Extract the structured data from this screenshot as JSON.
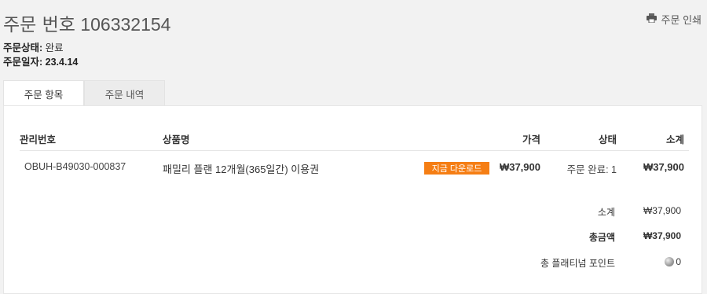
{
  "header": {
    "title_label": "주문 번호",
    "order_number": "106332154",
    "print_label": "주문 인쇄"
  },
  "meta": {
    "status_label": "주문상태:",
    "status_value": "완료",
    "date_label": "주문일자:",
    "date_value": "23.4.14"
  },
  "tabs": [
    {
      "label": "주문 항목",
      "active": true
    },
    {
      "label": "주문 내역",
      "active": false
    }
  ],
  "table": {
    "headers": {
      "id": "관리번호",
      "name": "상품명",
      "price": "가격",
      "status": "상태",
      "subtotal": "소계"
    },
    "rows": [
      {
        "id": "OBUH-B49030-000837",
        "name": "패밀리 플랜 12개월(365일간) 이용권",
        "download_label": "지금 다운로드",
        "price": "₩37,900",
        "status": "주문 완료: 1",
        "subtotal": "₩37,900"
      }
    ]
  },
  "summary": {
    "subtotal_label": "소계",
    "subtotal_value": "₩37,900",
    "total_label": "총금액",
    "total_value": "₩37,900",
    "points_label": "총 플래티넘 포인트",
    "points_value": "0"
  },
  "icons": {
    "print": "printer-icon",
    "points": "platinum-coin-icon"
  },
  "colors": {
    "accent": "#f57e14",
    "background": "#f2f2f2"
  }
}
